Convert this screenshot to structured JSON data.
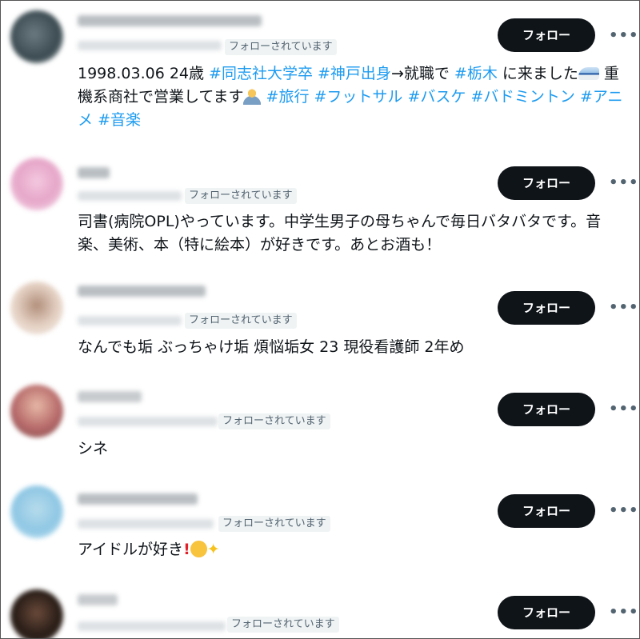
{
  "follow_label": "フォロー",
  "more_label": "•••",
  "followed_badge": "フォローされています",
  "users": [
    {
      "bio_parts": [
        {
          "t": "1998.03.06 24歳 ",
          "tag": false
        },
        {
          "t": "#同志社大学卒",
          "tag": true
        },
        {
          "t": " ",
          "tag": false
        },
        {
          "t": "#神戸出身",
          "tag": true
        },
        {
          "t": "→就職で ",
          "tag": false
        },
        {
          "t": "#栃木",
          "tag": true
        },
        {
          "t": " に来ました",
          "tag": false
        },
        {
          "emoji": "train-emoji"
        },
        {
          "t": " 重機系商社で営業してます",
          "tag": false
        },
        {
          "emoji": "office-worker-emoji"
        },
        {
          "t": " ",
          "tag": false
        },
        {
          "t": "#旅行",
          "tag": true
        },
        {
          "t": " ",
          "tag": false
        },
        {
          "t": "#フットサル",
          "tag": true
        },
        {
          "t": " ",
          "tag": false
        },
        {
          "t": "#バスケ",
          "tag": true
        },
        {
          "t": " ",
          "tag": false
        },
        {
          "t": "#バドミントン",
          "tag": true
        },
        {
          "t": " ",
          "tag": false
        },
        {
          "t": "#アニメ",
          "tag": true
        },
        {
          "t": " ",
          "tag": false
        },
        {
          "t": "#音楽",
          "tag": true
        }
      ]
    },
    {
      "bio_parts": [
        {
          "t": "司書(病院OPL)やっています。中学生男子の母ちゃんで毎日バタバタです。音楽、美術、本（特に絵本）が好きです。あとお酒も！",
          "tag": false
        }
      ]
    },
    {
      "bio_parts": [
        {
          "t": "なんでも垢 ぶっちゃけ垢 煩悩垢女 23 現役看護師 2年め",
          "tag": false
        }
      ]
    },
    {
      "bio_parts": [
        {
          "t": "シネ",
          "tag": false
        }
      ]
    },
    {
      "bio_parts": [
        {
          "t": "アイドルが好き",
          "tag": false
        },
        {
          "emoji": "red-exclamation-emoji"
        },
        {
          "emoji": "smiling-face-emoji"
        },
        {
          "emoji": "sparkles-emoji"
        }
      ]
    },
    {
      "bio_parts": []
    }
  ]
}
